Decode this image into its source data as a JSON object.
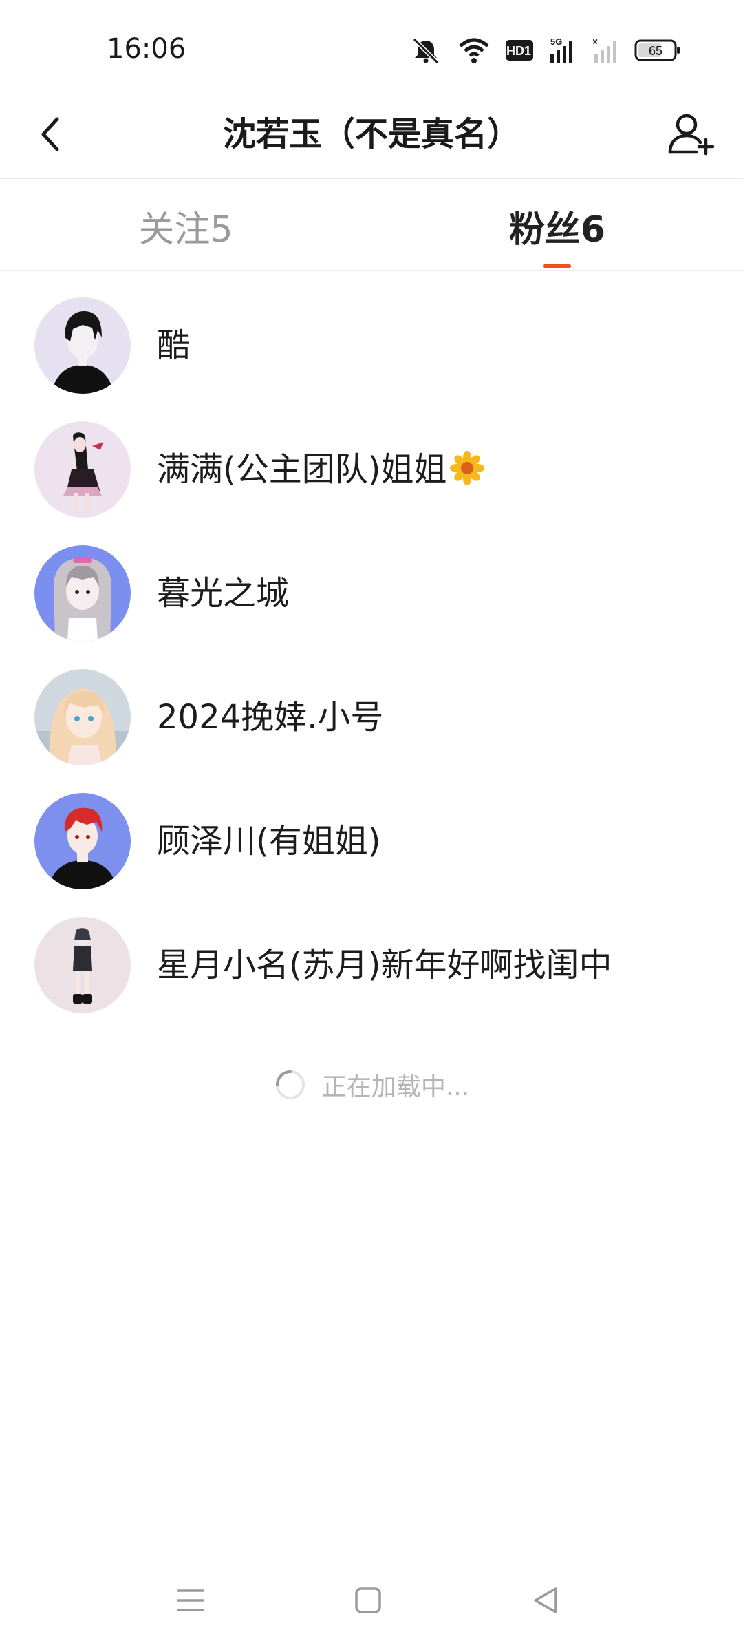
{
  "status_bar": {
    "time": "16:06",
    "battery": "65",
    "network": "5G",
    "hd_badge": "HD1",
    "icons": [
      "mute-icon",
      "wifi-icon",
      "hd-icon",
      "signal-icon",
      "signal-no-service-icon",
      "battery-icon"
    ]
  },
  "header": {
    "title": "沈若玉（不是真名）",
    "back_icon": "chevron-left-icon",
    "add_icon": "add-friend-icon"
  },
  "tabs": [
    {
      "label": "关注5",
      "active": false
    },
    {
      "label": "粉丝6",
      "active": true
    }
  ],
  "accent_color": "#f2511b",
  "fans": [
    {
      "name": "酷",
      "emoji": ""
    },
    {
      "name": "满满(公主团队)姐姐",
      "emoji": "flower-icon"
    },
    {
      "name": "暮光之城",
      "emoji": ""
    },
    {
      "name": "2024挽婞.小号",
      "emoji": ""
    },
    {
      "name": "顾泽川(有姐姐)",
      "emoji": ""
    },
    {
      "name": "星月小名(苏月)新年好啊找闺中",
      "emoji": ""
    }
  ],
  "loading": {
    "text": "正在加载中..."
  },
  "nav_bar": {
    "icons": [
      "menu-icon",
      "home-icon",
      "back-triangle-icon"
    ]
  }
}
